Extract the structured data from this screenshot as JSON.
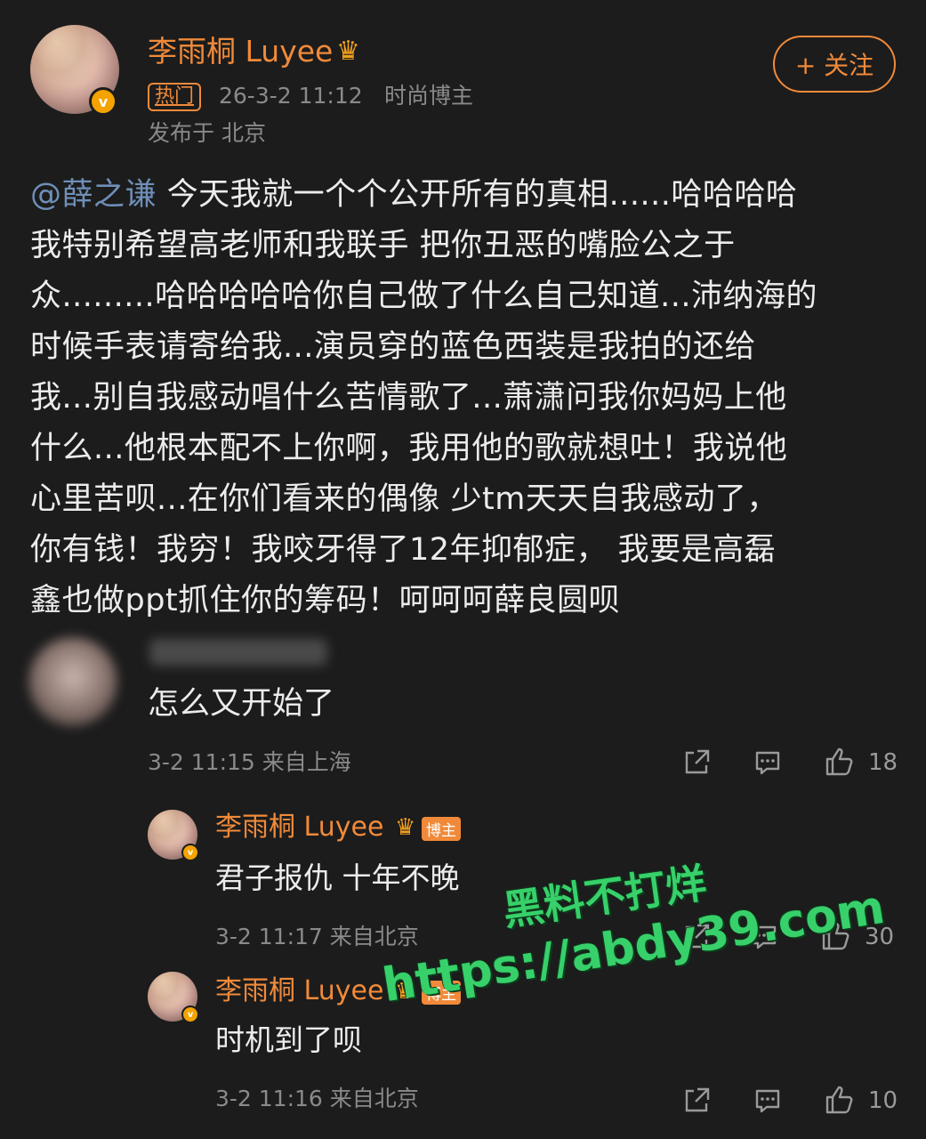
{
  "post": {
    "author": "李雨桐 Luyee",
    "hot_tag": "热门",
    "timestamp": "26-3-2 11:12",
    "role": "时尚博主",
    "location": "发布于 北京",
    "follow_label": "+ 关注",
    "mention": "@薛之谦",
    "lines": [
      " 今天我就一个个公开所有的真相......哈哈哈哈",
      "我特别希望高老师和我联手 把你丑恶的嘴脸公之于",
      "众.........哈哈哈哈哈你自己做了什么自己知道...沛纳海的",
      "时候手表请寄给我...演员穿的蓝色西装是我拍的还给",
      "我...别自我感动唱什么苦情歌了...萧潇问我你妈妈上他",
      "什么...他根本配不上你啊，我用他的歌就想吐！我说他",
      "心里苦呗...在你们看来的偶像 少tm天天自我感动了，",
      "你有钱！我穷！我咬牙得了12年抑郁症， 我要是高磊",
      "鑫也做ppt抓住你的筹码！呵呵呵薛良圆呗"
    ]
  },
  "comments": [
    {
      "text": "怎么又开始了",
      "meta": "3-2 11:15 来自上海",
      "likes": "18"
    }
  ],
  "replies": [
    {
      "author": "李雨桐 Luyee",
      "badge": "博主",
      "text": "君子报仇 十年不晚",
      "meta": "3-2 11:17 来自北京",
      "likes": "30"
    },
    {
      "author": "李雨桐 Luyee",
      "badge": "博主",
      "text": "时机到了呗",
      "meta": "3-2 11:16 来自北京",
      "likes": "10"
    }
  ],
  "watermark": {
    "line1": "黑料不打烊",
    "line2": "https://abdy39.com"
  },
  "colors": {
    "background": "#1c1c1c",
    "accent": "#f08a3a",
    "mention": "#6f8fb8",
    "watermark": "#37d06a"
  },
  "icons": [
    "share-icon",
    "comment-icon",
    "like-icon",
    "crown-icon",
    "verified-icon"
  ]
}
